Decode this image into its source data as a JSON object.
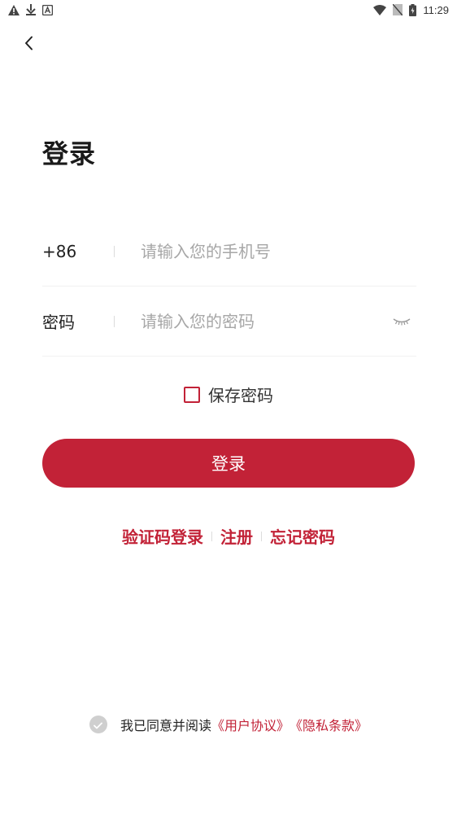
{
  "statusbar": {
    "left_icons": [
      "warning-icon",
      "download-icon",
      "a-icon"
    ],
    "right_icons": [
      "wifi-icon",
      "no-sim-icon",
      "battery-icon"
    ],
    "time": "11:29"
  },
  "nav": {
    "back_icon": "chevron-left-icon"
  },
  "page": {
    "title": "登录"
  },
  "form": {
    "phone": {
      "prefix": "+86",
      "placeholder": "请输入您的手机号",
      "value": ""
    },
    "password": {
      "label": "密码",
      "placeholder": "请输入您的密码",
      "value": "",
      "visibility_icon": "eye-closed-icon"
    },
    "save_password": {
      "label": "保存密码",
      "checked": false
    },
    "submit_label": "登录"
  },
  "links": {
    "sms_login": "验证码登录",
    "register": "注册",
    "forgot": "忘记密码"
  },
  "agreement": {
    "text": "我已同意并阅读",
    "user_agreement": "《用户协议》",
    "privacy_policy": "《隐私条款》"
  },
  "colors": {
    "accent": "#c22237",
    "placeholder": "#a7a7a7",
    "divider": "#f1f1f1"
  }
}
